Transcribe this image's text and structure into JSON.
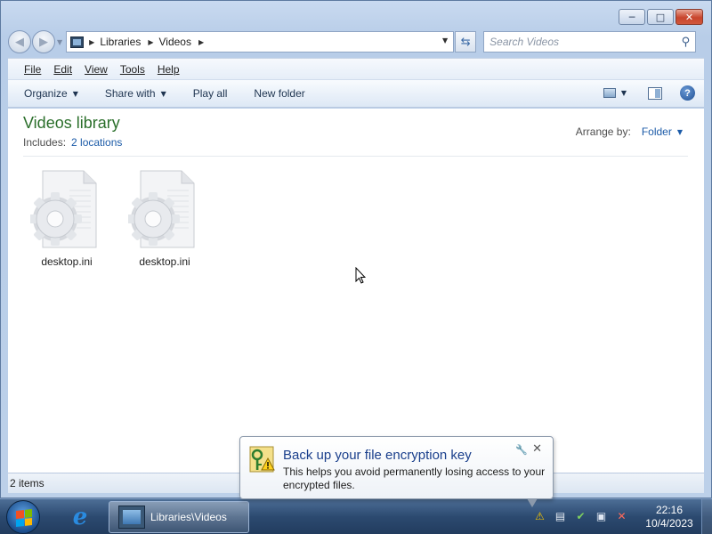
{
  "window": {
    "minimize_glyph": "─",
    "maximize_glyph": "□",
    "close_glyph": "✕"
  },
  "address_bar": {
    "crumbs": [
      "Libraries",
      "Videos"
    ],
    "search_placeholder": "Search Videos"
  },
  "menu": {
    "items": [
      "File",
      "Edit",
      "View",
      "Tools",
      "Help"
    ]
  },
  "command_bar": {
    "organize": "Organize",
    "share_with": "Share with",
    "play_all": "Play all",
    "new_folder": "New folder"
  },
  "library": {
    "title": "Videos library",
    "includes_label": "Includes:",
    "locations_link": "2 locations",
    "arrange_label": "Arrange by:",
    "arrange_value": "Folder"
  },
  "files": [
    {
      "name": "desktop.ini",
      "icon": "settings-file-icon"
    },
    {
      "name": "desktop.ini",
      "icon": "settings-file-icon"
    }
  ],
  "status": {
    "item_count": "2 items"
  },
  "notification": {
    "title": "Back up your file encryption key",
    "text": "This helps you avoid permanently losing access to your encrypted files."
  },
  "taskbar": {
    "task_label": "Libraries\\Videos",
    "time": "22:16",
    "date": "10/4/2023"
  },
  "colors": {
    "library_title": "#2b6f2b",
    "link": "#1c5ba8",
    "balloon_title": "#1a3f8c"
  }
}
